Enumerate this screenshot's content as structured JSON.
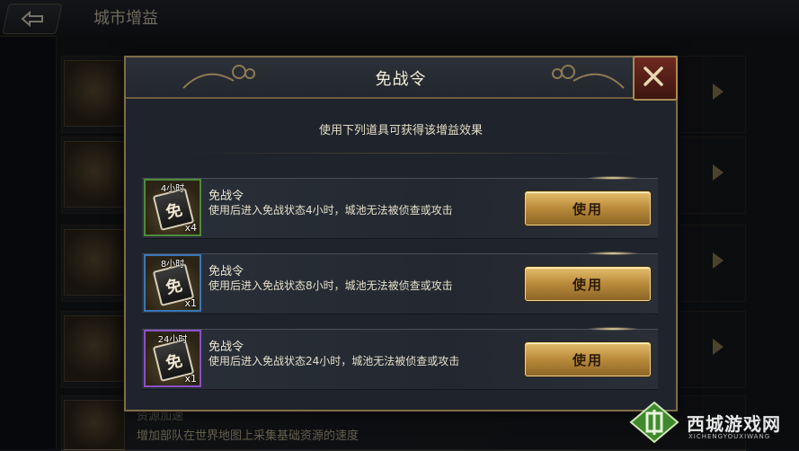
{
  "background": {
    "page_title": "城市增益",
    "resource_title": "资源加速",
    "resource_desc": "增加部队在世界地图上采集基础资源的速度"
  },
  "dialog": {
    "title": "免战令",
    "subtitle": "使用下列道具可获得该增益效果",
    "items": [
      {
        "duration": "4小时",
        "name": "免战令",
        "desc": "使用后进入免战状态4小时，城池无法被侦查或攻击",
        "count": "x4",
        "button": "使用",
        "frame_color": "#4e8a3a",
        "glyph": "免"
      },
      {
        "duration": "8小时",
        "name": "免战令",
        "desc": "使用后进入免战状态8小时，城池无法被侦查或攻击",
        "count": "x1",
        "button": "使用",
        "frame_color": "#3a77b6",
        "glyph": "免"
      },
      {
        "duration": "24小时",
        "name": "免战令",
        "desc": "使用后进入免战状态24小时，城池无法被侦查或攻击",
        "count": "x1",
        "button": "使用",
        "frame_color": "#8a4fc4",
        "glyph": "免"
      }
    ]
  },
  "watermark": {
    "name": "西城游戏网",
    "sub": "XICHENGYOUXIWANG"
  },
  "icons": {
    "back": "back-arrow-icon",
    "close": "close-x-icon",
    "row_arrow": "chevron-right-icon"
  },
  "colors": {
    "accent_gold": "#c9a04e",
    "dialog_bg": "#1f232b"
  }
}
